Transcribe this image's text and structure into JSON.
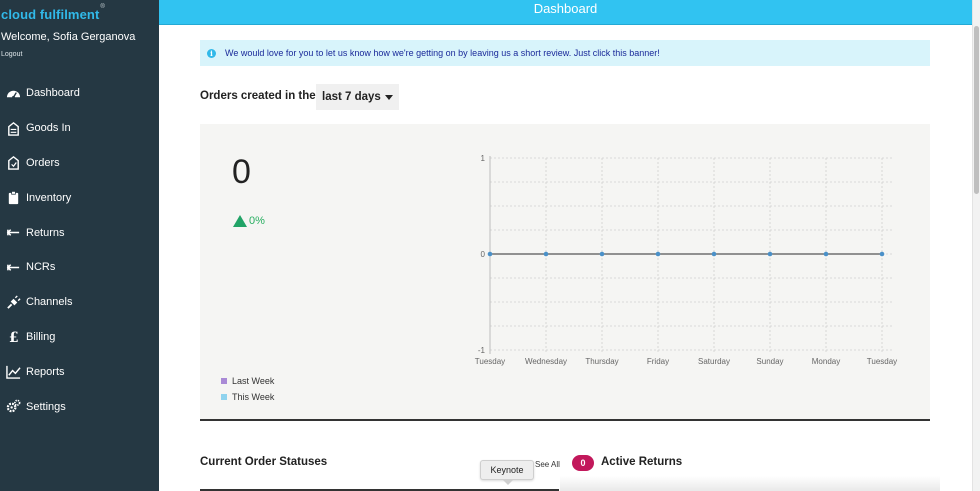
{
  "sidebar": {
    "brand": "cloud fulfilment",
    "brand_mark": "®",
    "welcome": "Welcome, Sofia Gerganova",
    "logout": "Logout",
    "items": [
      {
        "label": "Dashboard",
        "icon": "dashboard-icon"
      },
      {
        "label": "Goods In",
        "icon": "goods-in-icon"
      },
      {
        "label": "Orders",
        "icon": "orders-icon"
      },
      {
        "label": "Inventory",
        "icon": "inventory-icon"
      },
      {
        "label": "Returns",
        "icon": "returns-icon"
      },
      {
        "label": "NCRs",
        "icon": "ncrs-icon"
      },
      {
        "label": "Channels",
        "icon": "channels-icon"
      },
      {
        "label": "Billing",
        "icon": "billing-icon"
      },
      {
        "label": "Reports",
        "icon": "reports-icon"
      },
      {
        "label": "Settings",
        "icon": "settings-icon"
      }
    ]
  },
  "header": {
    "title": "Dashboard"
  },
  "banner": {
    "text": "We would love for you to let us know how we're getting on by leaving us a short review. Just click this banner!"
  },
  "orders": {
    "title": "Orders created in the",
    "period": "last 7 days",
    "count": "0",
    "change": "0%"
  },
  "legend": {
    "items": [
      {
        "label": "Last Week",
        "color": "#a98ad6"
      },
      {
        "label": "This Week",
        "color": "#8fd3ee"
      }
    ]
  },
  "chart_data": {
    "type": "line",
    "x": [
      "Tuesday",
      "Wednesday",
      "Thursday",
      "Friday",
      "Saturday",
      "Sunday",
      "Monday",
      "Tuesday"
    ],
    "series": [
      {
        "name": "This Week",
        "values": [
          0,
          0,
          0,
          0,
          0,
          0,
          0,
          0
        ]
      }
    ],
    "ylim": [
      -1,
      1
    ],
    "yticks": [
      "1",
      "0",
      "-1"
    ],
    "grid": true,
    "line_color": "#555555",
    "point_color": "#4a90c8"
  },
  "statuses": {
    "title": "Current Order Statuses",
    "see_all": "See All"
  },
  "returns": {
    "count": "0",
    "title": "Active Returns"
  },
  "tooltip": {
    "text": "Keynote"
  },
  "colors": {
    "sidebar": "#253843",
    "header": "#31c3f1",
    "brand": "#31b9e9",
    "positive": "#21a366",
    "badge": "#c2185b"
  }
}
